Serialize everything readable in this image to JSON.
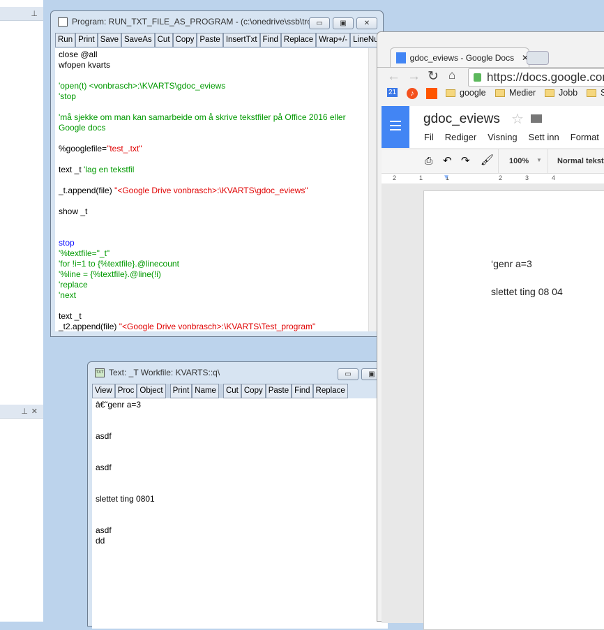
{
  "left_panes": [
    {
      "pin": "pin-icon"
    },
    {
      "pin": "pin-icon",
      "close": "×"
    }
  ],
  "program_window": {
    "title": "Program: RUN_TXT_FILE_AS_PROGRAM - (c:\\onedrive\\ssb\\trol...",
    "toolbar": [
      "Run",
      "Print",
      "Save",
      "SaveAs",
      "Cut",
      "Copy",
      "Paste",
      "InsertTxt",
      "Find",
      "Replace",
      "Wrap+/-",
      "LineNum"
    ],
    "lines": [
      [
        {
          "c": "k",
          "t": "close @all"
        }
      ],
      [
        {
          "c": "k",
          "t": "wfopen kvarts"
        }
      ],
      [],
      [
        {
          "c": "g",
          "t": "'open(t) <vonbrasch>:\\KVARTS\\gdoc_eviews"
        }
      ],
      [
        {
          "c": "g",
          "t": "'stop"
        }
      ],
      [],
      [
        {
          "c": "g",
          "t": "'må sjekke om man kan samarbeide om å skrive tekstfiler på Office 2016 eller"
        }
      ],
      [
        {
          "c": "g",
          "t": "Google docs"
        }
      ],
      [],
      [
        {
          "c": "k",
          "t": "%googlefile="
        },
        {
          "c": "r",
          "t": "\"test_.txt\""
        }
      ],
      [],
      [
        {
          "c": "k",
          "t": "text _t "
        },
        {
          "c": "g",
          "t": "'lag en tekstfil"
        }
      ],
      [],
      [
        {
          "c": "k",
          "t": "_t.append(file) "
        },
        {
          "c": "r",
          "t": "\"<Google Drive vonbrasch>:\\KVARTS\\gdoc_eviews\""
        }
      ],
      [],
      [
        {
          "c": "k",
          "t": "show _t"
        }
      ],
      [],
      [],
      [
        {
          "c": "b",
          "t": "stop"
        }
      ],
      [
        {
          "c": "g",
          "t": "'%textfile=\"_t\""
        }
      ],
      [
        {
          "c": "g",
          "t": "'for !i=1 to {%textfile}.@linecount"
        }
      ],
      [
        {
          "c": "g",
          "t": "'%line = {%textfile}.@line(!i)"
        }
      ],
      [
        {
          "c": "g",
          "t": "'replace"
        }
      ],
      [
        {
          "c": "g",
          "t": "'next"
        }
      ],
      [],
      [
        {
          "c": "k",
          "t": "text _t"
        }
      ],
      [
        {
          "c": "k",
          "t": "_t2.append(file) "
        },
        {
          "c": "r",
          "t": "\"<Google Drive vonbrasch>:\\KVARTS\\Test_program\""
        }
      ]
    ]
  },
  "text_window": {
    "icon": "TXT",
    "title": "Text: _T   Workfile: KVARTS::q\\",
    "toolbar": [
      "View",
      "Proc",
      "Object",
      "Print",
      "Name",
      "Cut",
      "Copy",
      "Paste",
      "Find",
      "Replace"
    ],
    "lines": [
      "â€˜genr a=3",
      "",
      "",
      "asdf",
      "",
      "",
      "asdf",
      "",
      "",
      "slettet ting 0801",
      "",
      "",
      "asdf",
      "dd"
    ]
  },
  "browser": {
    "tab_title": "gdoc_eviews - Google Docs",
    "url": "https://docs.google.com",
    "bookmarks": [
      {
        "icon": "calendar-icon",
        "label": "21"
      },
      {
        "icon": "music-icon",
        "label": "♪"
      },
      {
        "icon": "soundcloud-icon",
        "label": ""
      },
      {
        "label": "google"
      },
      {
        "label": "Medier"
      },
      {
        "label": "Jobb"
      },
      {
        "label": "S"
      }
    ],
    "doc": {
      "title": "gdoc_eviews",
      "menu": [
        "Fil",
        "Rediger",
        "Visning",
        "Sett inn",
        "Format"
      ],
      "zoom": "100%",
      "style": "Normal tekst",
      "ruler": [
        "2",
        "1",
        "1",
        "2",
        "3",
        "4"
      ],
      "lines": [
        "‘genr a=3",
        "slettet ting 08 04"
      ]
    },
    "accent": "#4285f4"
  }
}
